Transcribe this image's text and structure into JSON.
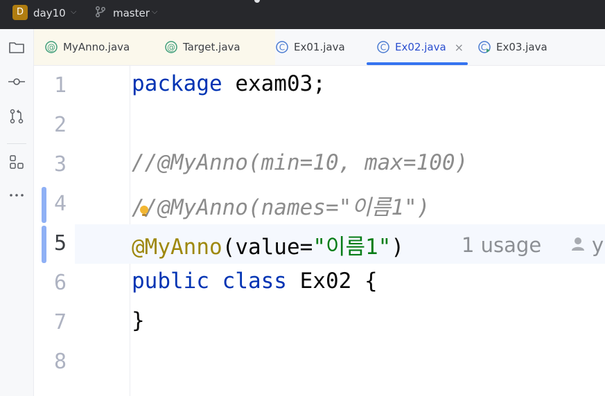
{
  "titlebar": {
    "project_badge": "D",
    "project_name": "day10",
    "branch_name": "master"
  },
  "toolstrip": {
    "icons": [
      "folder-icon",
      "commit-icon",
      "pull-request-icon",
      "structure-icon",
      "more-icon"
    ]
  },
  "tabs": [
    {
      "label": "MyAnno.java",
      "icon": "annotation-icon",
      "modified": true
    },
    {
      "label": "Target.java",
      "icon": "annotation-icon",
      "modified": true
    },
    {
      "label": "Ex01.java",
      "icon": "class-icon",
      "modified": false
    },
    {
      "label": "Ex02.java",
      "icon": "class-icon",
      "modified": false,
      "active": true,
      "close": "×"
    },
    {
      "label": "Ex03.java",
      "icon": "class-run-icon",
      "modified": false
    }
  ],
  "editor": {
    "line_numbers": [
      "1",
      "2",
      "3",
      "4",
      "5",
      "6",
      "7",
      "8"
    ],
    "current_line": 5,
    "lines": {
      "l1_kw": "package",
      "l1_rest": " exam03;",
      "l3": "//@MyAnno(min=10, max=100)",
      "l4": "//@MyAnno(names=\"이름1\")",
      "l5_ann": "@MyAnno",
      "l5_open": "(value=",
      "l5_str": "\"이름1\"",
      "l5_close": ")",
      "l6_kw1": "public",
      "l6_kw2": "class",
      "l6_rest": " Ex02 {",
      "l7": "}"
    },
    "inlay_usage": "1 usage",
    "inlay_author": "y"
  },
  "colors": {
    "keyword": "#0033b3",
    "comment": "#8c8c8c",
    "annotation": "#9e880d",
    "string": "#067d17",
    "accent": "#3574f0"
  }
}
